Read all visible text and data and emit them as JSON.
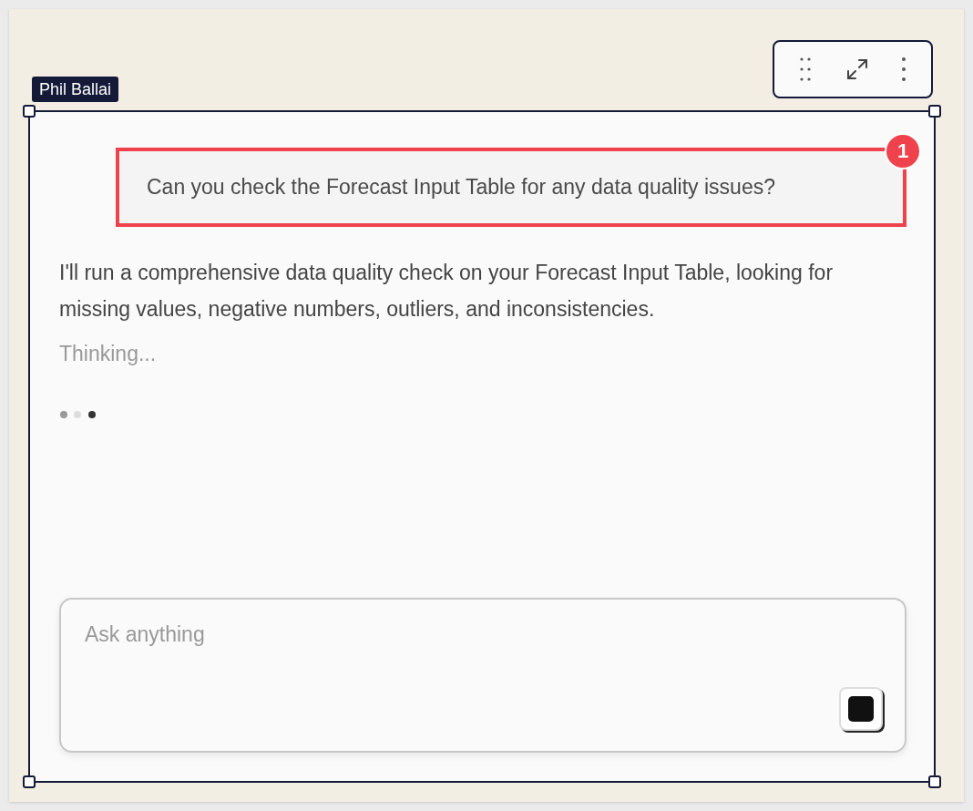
{
  "owner_tag": "Phil Ballai",
  "toolbar": [
    {
      "kind": "drag"
    },
    {
      "kind": "expand"
    },
    {
      "kind": "more"
    }
  ],
  "user_message": {
    "text": "Can you check the Forecast Input Table for any data quality issues?",
    "highlighted": true,
    "marker": "1"
  },
  "assistant_message": "I'll run a comprehensive data quality check on your Forecast Input Table, looking for missing values, negative numbers, outliers, and inconsistencies.",
  "status": "Thinking...",
  "input": {
    "placeholder": "Ask anything"
  }
}
